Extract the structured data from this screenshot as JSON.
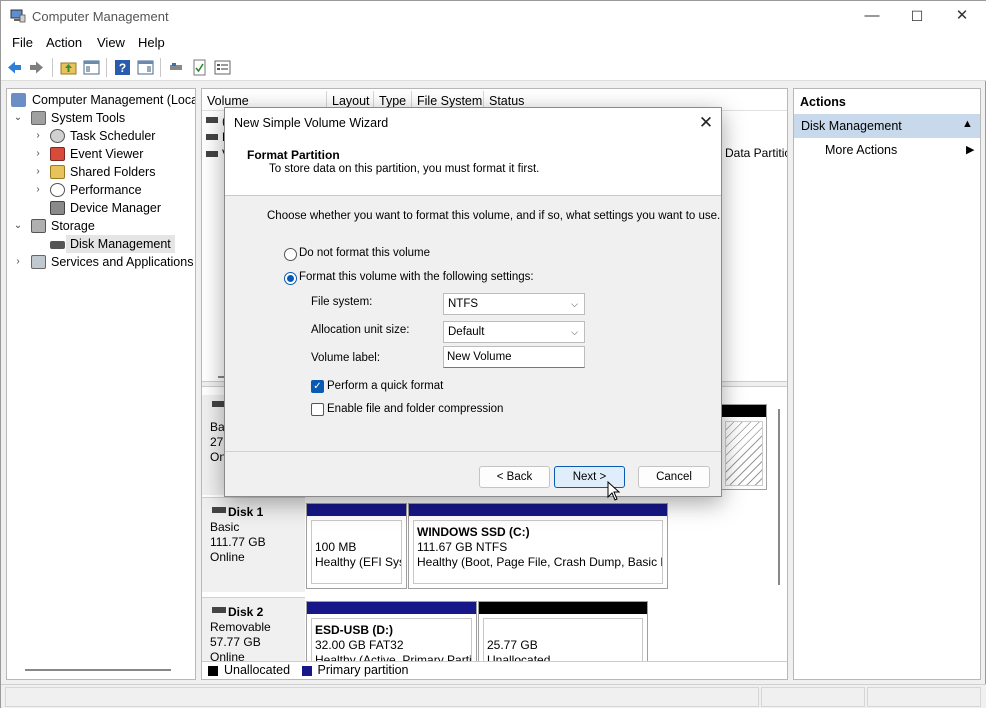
{
  "window": {
    "title": "Computer Management"
  },
  "caption_buttons": {
    "minimize": "—",
    "maximize": "☐",
    "close": "✕"
  },
  "menu": [
    "File",
    "Action",
    "View",
    "Help"
  ],
  "tree": {
    "root": "Computer Management (Local",
    "system_tools": "System Tools",
    "task_scheduler": "Task Scheduler",
    "event_viewer": "Event Viewer",
    "shared_folders": "Shared Folders",
    "performance": "Performance",
    "device_manager": "Device Manager",
    "storage": "Storage",
    "disk_management": "Disk Management",
    "services": "Services and Applications"
  },
  "volume_list": {
    "columns": [
      "Volume",
      "Layout",
      "Type",
      "File System",
      "Status"
    ],
    "row_fragments": [
      "(",
      "E",
      "V"
    ],
    "status_fragment": "Data Partitio"
  },
  "disks": {
    "disk0": {
      "fragment_basic": "Bas",
      "fragment_size": "279",
      "fragment_online": "On"
    },
    "disk1": {
      "name": "Disk 1",
      "type": "Basic",
      "size": "111.77 GB",
      "status": "Online",
      "partitions": [
        {
          "title": "",
          "size": "100 MB",
          "detail": "Healthy (EFI Syst"
        },
        {
          "title": "WINDOWS SSD  (C:)",
          "size": "111.67 GB NTFS",
          "detail": "Healthy (Boot, Page File, Crash Dump, Basic Da"
        }
      ]
    },
    "disk2": {
      "name": "Disk 2",
      "type": "Removable",
      "size": "57.77 GB",
      "status": "Online",
      "partitions": [
        {
          "title": "ESD-USB  (D:)",
          "size": "32.00 GB FAT32",
          "detail": "Healthy (Active, Primary Parti"
        },
        {
          "title": "",
          "size": "25.77 GB",
          "detail": "Unallocated"
        }
      ]
    }
  },
  "legend": {
    "unallocated": "Unallocated",
    "primary": "Primary partition"
  },
  "actions": {
    "title": "Actions",
    "section": "Disk Management",
    "more": "More Actions"
  },
  "dialog": {
    "title": "New Simple Volume Wizard",
    "heading": "Format Partition",
    "subheading": "To store data on this partition, you must format it first.",
    "instruction": "Choose whether you want to format this volume, and if so, what settings you want to use.",
    "radio_no_format": "Do not format this volume",
    "radio_format": "Format this volume with the following settings:",
    "file_system_label": "File system:",
    "file_system_value": "NTFS",
    "alloc_label": "Allocation unit size:",
    "alloc_value": "Default",
    "volume_label_label": "Volume label:",
    "volume_label_value": "New Volume",
    "quick_format": "Perform a quick format",
    "quick_format_checked": true,
    "compression": "Enable file and folder compression",
    "compression_checked": false,
    "back": "< Back",
    "next": "Next >",
    "cancel": "Cancel"
  },
  "colors": {
    "primary_partition": "#17178a",
    "unallocated": "#000000",
    "selection": "#c8d9ec",
    "accent": "#0a5ab4"
  }
}
